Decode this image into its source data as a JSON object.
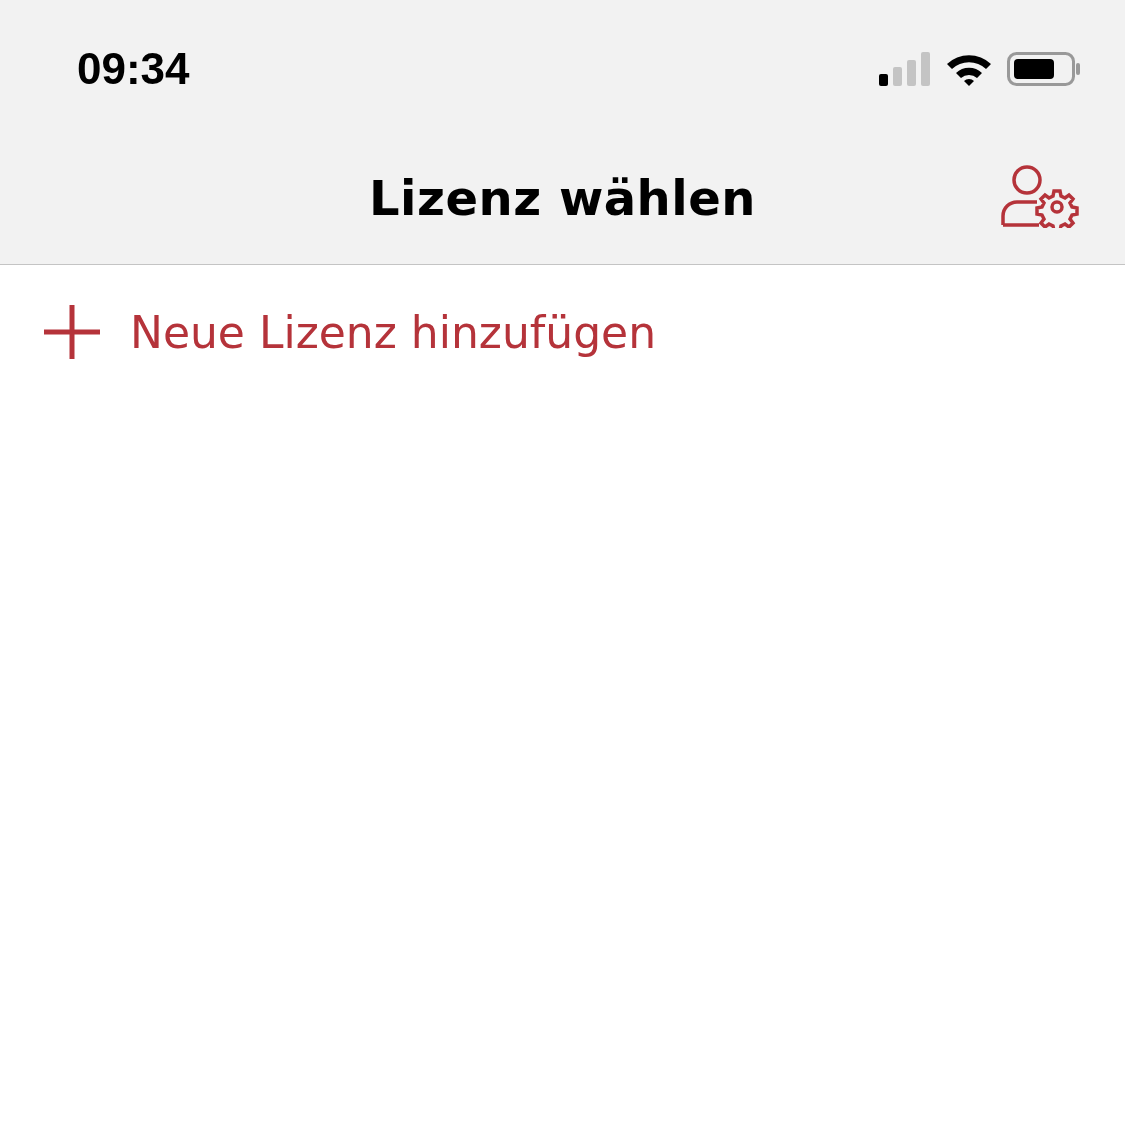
{
  "status_bar": {
    "time": "09:34"
  },
  "nav_bar": {
    "title": "Lizenz wählen"
  },
  "actions": [
    {
      "label": "Neue Lizenz hinzufügen"
    }
  ]
}
